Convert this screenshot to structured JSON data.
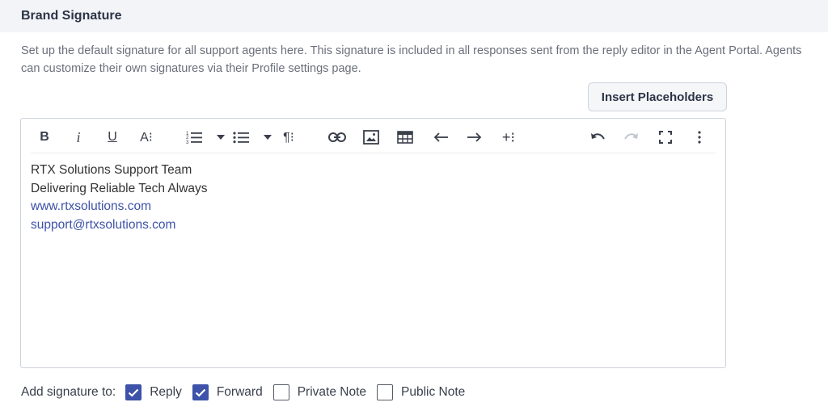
{
  "section": {
    "title": "Brand Signature",
    "description": "Set up the default signature for all support agents here. This signature is included in all responses sent from the reply editor in the Agent Portal. Agents can customize their own signatures via their Profile settings page."
  },
  "insert_button": {
    "label": "Insert Placeholders"
  },
  "toolbar": {
    "bold": "B",
    "italic": "i",
    "underline": "U",
    "font_size": "A⁝",
    "paragraph": "¶⁝",
    "insert_more": "+⁝",
    "icons": [
      "bold-icon",
      "italic-icon",
      "underline-icon",
      "font-size-icon",
      "ordered-list-icon",
      "unordered-list-icon",
      "paragraph-format-icon",
      "link-icon",
      "image-icon",
      "table-icon",
      "outdent-icon",
      "indent-icon",
      "insert-more-icon",
      "undo-icon",
      "redo-icon",
      "fullscreen-icon",
      "more-options-icon"
    ]
  },
  "signature": {
    "line1": "RTX Solutions Support Team",
    "line2": "Delivering Reliable Tech Always",
    "website": "www.rtxsolutions.com",
    "email": "support@rtxsolutions.com"
  },
  "add_signature": {
    "label": "Add signature to:",
    "options": [
      {
        "label": "Reply",
        "checked": true
      },
      {
        "label": "Forward",
        "checked": true
      },
      {
        "label": "Private Note",
        "checked": false
      },
      {
        "label": "Public Note",
        "checked": false
      }
    ]
  },
  "colors": {
    "accent": "#3d52a8",
    "header_bg": "#f3f4f7",
    "text": "#333333"
  }
}
